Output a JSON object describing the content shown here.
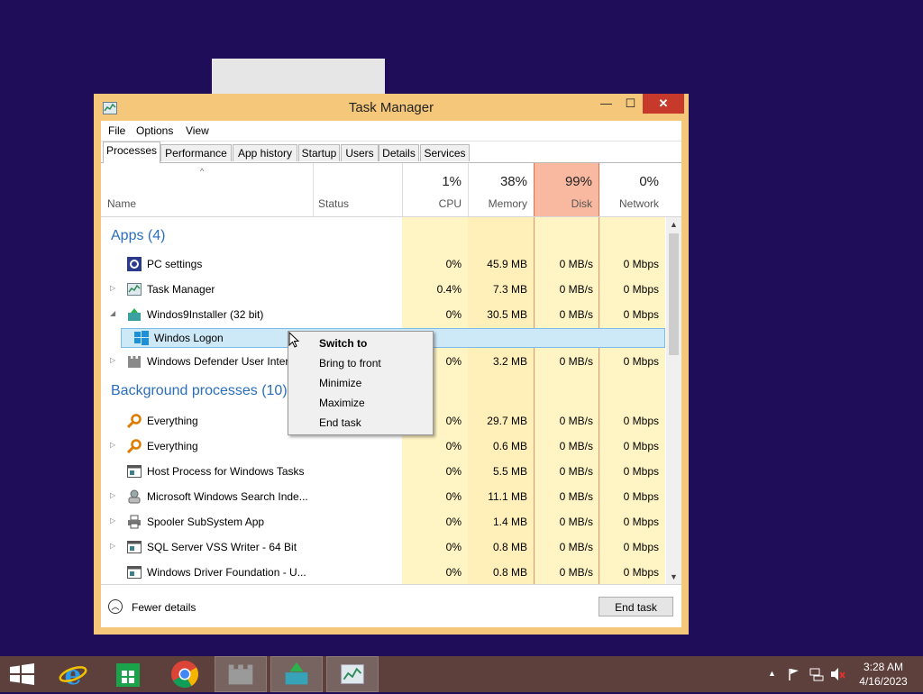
{
  "window": {
    "title": "Task Manager",
    "min_glyph": "—",
    "max_glyph": "☐",
    "close_glyph": "✕"
  },
  "menu": [
    "File",
    "Options",
    "View"
  ],
  "tabs": [
    "Processes",
    "Performance",
    "App history",
    "Startup",
    "Users",
    "Details",
    "Services"
  ],
  "active_tab": "Processes",
  "columns": {
    "name": "Name",
    "status": "Status",
    "cpu": {
      "pct": "1%",
      "label": "CPU"
    },
    "memory": {
      "pct": "38%",
      "label": "Memory"
    },
    "disk": {
      "pct": "99%",
      "label": "Disk"
    },
    "network": {
      "pct": "0%",
      "label": "Network"
    }
  },
  "groups": {
    "apps": "Apps (4)",
    "background": "Background processes (10)"
  },
  "apps": [
    {
      "name": "PC settings",
      "cpu": "0%",
      "mem": "45.9 MB",
      "disk": "0 MB/s",
      "net": "0 Mbps",
      "expand": "",
      "icon": "gear-icon"
    },
    {
      "name": "Task Manager",
      "cpu": "0.4%",
      "mem": "7.3 MB",
      "disk": "0 MB/s",
      "net": "0 Mbps",
      "expand": "▷",
      "icon": "task-manager-icon"
    },
    {
      "name": "Windos9Installer (32 bit)",
      "cpu": "0%",
      "mem": "30.5 MB",
      "disk": "0 MB/s",
      "net": "0 Mbps",
      "expand": "◢",
      "icon": "installer-icon"
    },
    {
      "name": "Windos Logon",
      "cpu": "",
      "mem": "",
      "disk": "",
      "net": "",
      "expand": "",
      "icon": "windows-logo-icon"
    },
    {
      "name": "Windows Defender User Interf",
      "cpu": "0%",
      "mem": "3.2 MB",
      "disk": "0 MB/s",
      "net": "0 Mbps",
      "expand": "▷",
      "icon": "castle-icon"
    }
  ],
  "background": [
    {
      "name": "Everything",
      "cpu": "0%",
      "mem": "29.7 MB",
      "disk": "0 MB/s",
      "net": "0 Mbps",
      "expand": "",
      "icon": "magnifier-icon"
    },
    {
      "name": "Everything",
      "cpu": "0%",
      "mem": "0.6 MB",
      "disk": "0 MB/s",
      "net": "0 Mbps",
      "expand": "▷",
      "icon": "magnifier-icon"
    },
    {
      "name": "Host Process for Windows Tasks",
      "cpu": "0%",
      "mem": "5.5 MB",
      "disk": "0 MB/s",
      "net": "0 Mbps",
      "expand": "",
      "icon": "window-icon"
    },
    {
      "name": "Microsoft Windows Search Inde...",
      "cpu": "0%",
      "mem": "11.1 MB",
      "disk": "0 MB/s",
      "net": "0 Mbps",
      "expand": "▷",
      "icon": "search-indexer-icon"
    },
    {
      "name": "Spooler SubSystem App",
      "cpu": "0%",
      "mem": "1.4 MB",
      "disk": "0 MB/s",
      "net": "0 Mbps",
      "expand": "▷",
      "icon": "printer-icon"
    },
    {
      "name": "SQL Server VSS Writer - 64 Bit",
      "cpu": "0%",
      "mem": "0.8 MB",
      "disk": "0 MB/s",
      "net": "0 Mbps",
      "expand": "▷",
      "icon": "window-icon"
    },
    {
      "name": "Windows Driver Foundation - U...",
      "cpu": "0%",
      "mem": "0.8 MB",
      "disk": "0 MB/s",
      "net": "0 Mbps",
      "expand": "",
      "icon": "window-icon"
    }
  ],
  "context_menu": [
    "Switch to",
    "Bring to front",
    "Minimize",
    "Maximize",
    "End task"
  ],
  "footer": {
    "fewer_details": "Fewer details",
    "end_task": "End task"
  },
  "taskbar": {
    "apps": [
      "start-icon",
      "internet-explorer-icon",
      "store-icon",
      "chrome-icon",
      "castle-app-icon",
      "installer-app-icon",
      "task-manager-app-icon"
    ],
    "clock_time": "3:28 AM",
    "clock_date": "4/16/2023"
  },
  "colors": {
    "desktop": "#1f0d5a",
    "window_frame": "#f5c77a",
    "close_button": "#c7392b",
    "disk_header": "#f9b9a1",
    "group_text": "#2a6ebd",
    "taskbar": "#5d3f3c"
  }
}
